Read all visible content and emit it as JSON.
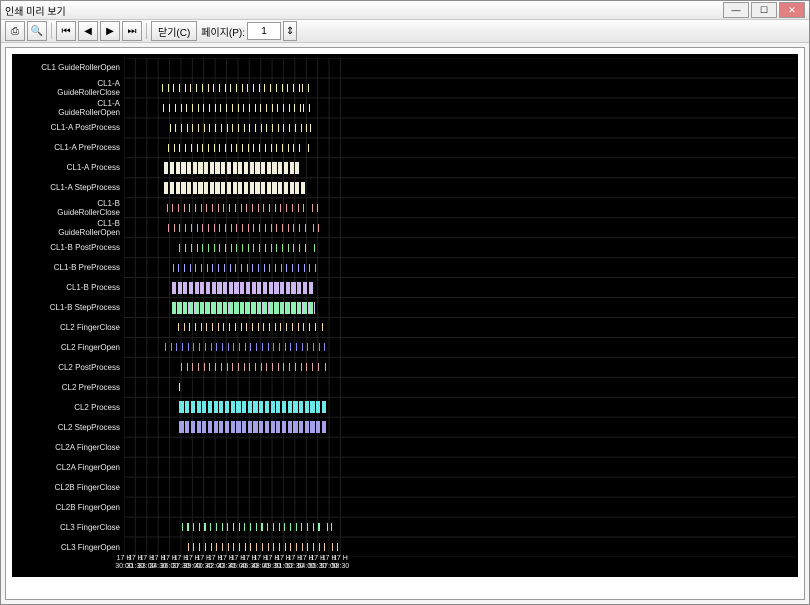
{
  "window": {
    "title": "인쇄 미리 보기",
    "minimize": "—",
    "maximize": "☐",
    "close": "✕"
  },
  "toolbar": {
    "print_icon": "⎙",
    "search_icon": "🔍",
    "nav_first": "⏮",
    "nav_prev": "◀",
    "nav_next": "▶",
    "nav_last": "⏭",
    "close_label": "닫기(C)",
    "page_label": "페이지(P):",
    "page_value": "1",
    "page_stepper": "⇕"
  },
  "chart_data": {
    "type": "gantt",
    "x_unit": "time",
    "x_start": 1050,
    "x_end": 1138.5,
    "x_ticks": [
      {
        "v": 1050,
        "top": "17 H",
        "bot": "30:00"
      },
      {
        "v": 1051.5,
        "top": "17 H",
        "bot": "31:30"
      },
      {
        "v": 1053,
        "top": "17 H",
        "bot": "33:00"
      },
      {
        "v": 1054.5,
        "top": "17 H",
        "bot": "34:30"
      },
      {
        "v": 1056,
        "top": "17 H",
        "bot": "36:00"
      },
      {
        "v": 1057.5,
        "top": "17 H",
        "bot": "37:30"
      },
      {
        "v": 1059,
        "top": "17 H",
        "bot": "39:00"
      },
      {
        "v": 1060.5,
        "top": "17 H",
        "bot": "40:30"
      },
      {
        "v": 1062,
        "top": "17 H",
        "bot": "42:00"
      },
      {
        "v": 1063.5,
        "top": "17 H",
        "bot": "43:30"
      },
      {
        "v": 1065,
        "top": "17 H",
        "bot": "45:00"
      },
      {
        "v": 1066.5,
        "top": "17 H",
        "bot": "46:30"
      },
      {
        "v": 1068,
        "top": "17 H",
        "bot": "48:00"
      },
      {
        "v": 1069.5,
        "top": "17 H",
        "bot": "49:30"
      },
      {
        "v": 1071,
        "top": "17 H",
        "bot": "51:00"
      },
      {
        "v": 1072.5,
        "top": "17 H",
        "bot": "52:30"
      },
      {
        "v": 1074,
        "top": "17 H",
        "bot": "54:00"
      },
      {
        "v": 1075.5,
        "top": "17 H",
        "bot": "55:30"
      },
      {
        "v": 1077,
        "top": "17 H",
        "bot": "57:00"
      },
      {
        "v": 1078.5,
        "top": "17 H",
        "bot": "58:30"
      }
    ],
    "row_labels": [
      "CL1 GuideRollerOpen",
      "CL1-A\nGuideRollerClose",
      "CL1-A\nGuideRollerOpen",
      "CL1-A PostProcess",
      "CL1-A PreProcess",
      "CL1-A Process",
      "CL1-A StepProcess",
      "CL1-B\nGuideRollerClose",
      "CL1-B\nGuideRollerOpen",
      "CL1-B PostProcess",
      "CL1-B PreProcess",
      "CL1-B Process",
      "CL1-B StepProcess",
      "CL2 FingerClose",
      "CL2 FingerOpen",
      "CL2 PostProcess",
      "CL2 PreProcess",
      "CL2 Process",
      "CL2 StepProcess",
      "CL2A FingerClose",
      "CL2A FingerOpen",
      "CL2B FingerClose",
      "CL2B FingerOpen",
      "CL3 FingerClose",
      "CL3 FingerOpen"
    ],
    "rows": [
      {
        "color": "#f5efad",
        "h": 8,
        "pattern": "none"
      },
      {
        "color": "#f5efad",
        "h": 8,
        "pattern": "thin",
        "start": 1055,
        "end": 1073,
        "step": 0.75,
        "w": 0.08,
        "post": [
          1073.4,
          1074.2
        ]
      },
      {
        "color": "#f5efad",
        "h": 8,
        "pattern": "thin",
        "start": 1055.2,
        "end": 1073.2,
        "step": 0.75,
        "w": 0.08,
        "post": [
          1073.6,
          1074.4
        ]
      },
      {
        "color": "#f5efad",
        "h": 8,
        "pattern": "thin",
        "start": 1056,
        "end": 1074,
        "step": 0.75,
        "w": 0.1,
        "post": [
          1074.5
        ]
      },
      {
        "color": "#f5efad",
        "h": 8,
        "pattern": "thin",
        "start": 1055.8,
        "end": 1073.6,
        "step": 0.75,
        "w": 0.1,
        "post": [
          1074.2
        ]
      },
      {
        "color": "#f2f0dc",
        "h": 12,
        "pattern": "wide",
        "start": 1055.3,
        "end": 1073,
        "step": 0.75,
        "w": 0.55
      },
      {
        "color": "#f2f0dc",
        "h": 12,
        "pattern": "wide",
        "start": 1055.3,
        "end": 1073.9,
        "step": 0.75,
        "w": 0.55
      },
      {
        "color": "#e9a1a8",
        "h": 8,
        "pattern": "thin",
        "start": 1055.6,
        "end": 1074.3,
        "step": 0.75,
        "w": 0.08,
        "post": [
          1074.8,
          1075.4
        ]
      },
      {
        "color": "#e9a1a8",
        "h": 8,
        "pattern": "thin",
        "start": 1055.8,
        "end": 1074.4,
        "step": 0.75,
        "w": 0.08,
        "post": [
          1074.9,
          1075.5
        ]
      },
      {
        "color": "#8ee68e",
        "h": 8,
        "pattern": "thin",
        "start": 1057.3,
        "end": 1074.3,
        "step": 0.75,
        "w": 0.1,
        "post": [
          1075
        ]
      },
      {
        "color": "#a6a6ff",
        "h": 8,
        "pattern": "thin",
        "start": 1056.4,
        "end": 1074.4,
        "step": 0.75,
        "w": 0.1,
        "post": [
          1075.2
        ]
      },
      {
        "color": "#cdb6f0",
        "h": 12,
        "pattern": "wide",
        "start": 1056.3,
        "end": 1074.4,
        "step": 0.75,
        "w": 0.55
      },
      {
        "color": "#8ef0b0",
        "h": 12,
        "pattern": "wide",
        "start": 1056.3,
        "end": 1074.4,
        "step": 0.75,
        "w": 0.55,
        "double": true
      },
      {
        "color": "#f5d9a6",
        "h": 8,
        "pattern": "thin",
        "start": 1057.1,
        "end": 1075.5,
        "step": 0.75,
        "w": 0.1,
        "post": [
          1076.1
        ]
      },
      {
        "color": "#8a8af0",
        "h": 8,
        "pattern": "thin",
        "start": 1055.4,
        "end": 1075.7,
        "step": 0.75,
        "w": 0.1,
        "post": [
          1076.3
        ]
      },
      {
        "color": "#e0a6a6",
        "h": 8,
        "pattern": "thin",
        "start": 1057.5,
        "end": 1075.9,
        "step": 0.75,
        "w": 0.1,
        "post": [
          1076.5
        ]
      },
      {
        "color": "#e6e6c0",
        "h": 8,
        "pattern": "thin",
        "start": 1057.3,
        "end": 1057.3,
        "step": 0.75,
        "w": 0.1
      },
      {
        "color": "#6de8e8",
        "h": 12,
        "pattern": "wide",
        "start": 1057.3,
        "end": 1076.7,
        "step": 0.75,
        "w": 0.55
      },
      {
        "color": "#a6a0e8",
        "h": 12,
        "pattern": "wide",
        "start": 1057.3,
        "end": 1076.7,
        "step": 0.75,
        "w": 0.55
      },
      {
        "color": "#999",
        "h": 8,
        "pattern": "none"
      },
      {
        "color": "#999",
        "h": 8,
        "pattern": "none"
      },
      {
        "color": "#999",
        "h": 8,
        "pattern": "none"
      },
      {
        "color": "#999",
        "h": 8,
        "pattern": "none"
      },
      {
        "color": "#8ef0b0",
        "h": 8,
        "pattern": "thin",
        "start": 1057.6,
        "end": 1076,
        "step": 0.75,
        "w": 0.15,
        "post": [
          1076.7,
          1077.3
        ]
      },
      {
        "color": "#f0c89a",
        "h": 8,
        "pattern": "thin",
        "start": 1058.4,
        "end": 1076.7,
        "step": 0.75,
        "w": 0.1,
        "post": [
          1077.4,
          1078
        ]
      }
    ]
  }
}
